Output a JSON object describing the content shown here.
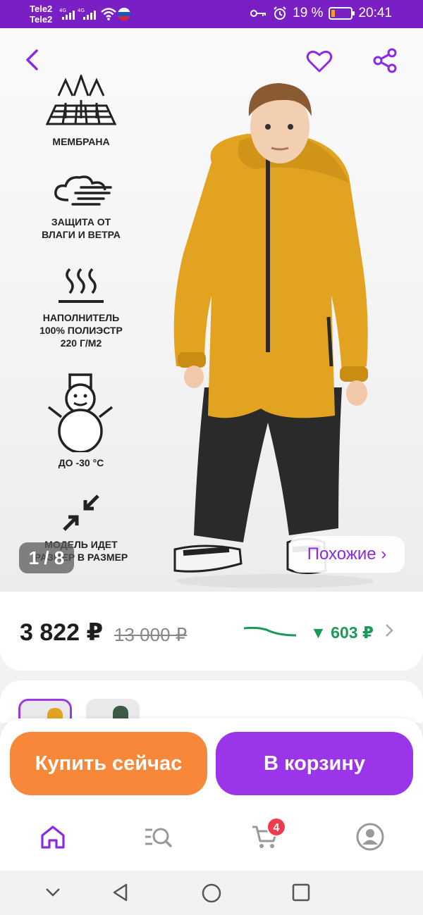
{
  "status_bar": {
    "carrier_1": "Tele2",
    "carrier_2": "Tele2",
    "network_1": "4G",
    "network_2": "4G",
    "battery": "19 %",
    "battery_level": 0.19,
    "time": "20:41",
    "icons": [
      "signal-icon",
      "wifi-icon",
      "russian-flag-icon",
      "key-icon",
      "alarm-icon",
      "battery-icon"
    ]
  },
  "gallery": {
    "counter": "1 / 8",
    "similar_label": "Похожие ›",
    "features": [
      {
        "icon": "membrane-icon",
        "label": "МЕМБРАНА"
      },
      {
        "icon": "wind-icon",
        "label": "ЗАЩИТА ОТ\nВЛАГИ И ВЕТРА"
      },
      {
        "icon": "heat-icon",
        "label": "НАПОЛНИТЕЛЬ\n100% ПОЛИЭСТР\n220 Г/М2"
      },
      {
        "icon": "snowman-icon",
        "label": "ДО -30 °C"
      },
      {
        "icon": "arrows-in-icon",
        "label": "МОДЕЛЬ ИДЕТ\nРАЗМЕР В РАЗМЕР"
      }
    ]
  },
  "price": {
    "current": "3 822 ₽",
    "old": "13 000 ₽",
    "change": "▼ 603 ₽"
  },
  "actions": {
    "buy_now": "Купить сейчас",
    "to_cart": "В корзину"
  },
  "tab_bar": {
    "cart_count": "4",
    "tabs": [
      "home-icon",
      "catalog-search-icon",
      "cart-icon",
      "profile-icon"
    ]
  },
  "colors": {
    "accent": "#9b35ea",
    "status_bar": "#7a1fc4",
    "buy_now": "#f7883a",
    "price_drop": "#1a9a5a",
    "badge": "#f03b4f"
  }
}
